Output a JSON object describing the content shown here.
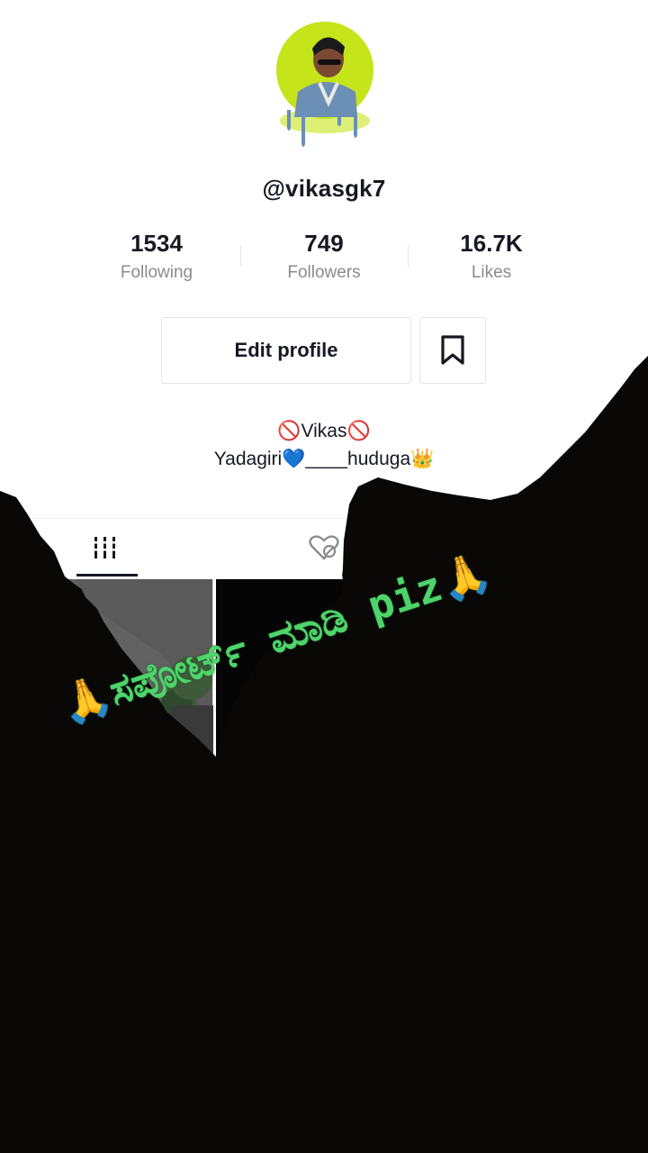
{
  "profile": {
    "username": "@vikasgk7",
    "stats": [
      {
        "value": "1534",
        "label": "Following"
      },
      {
        "value": "749",
        "label": "Followers"
      },
      {
        "value": "16.7K",
        "label": "Likes"
      }
    ],
    "edit_label": "Edit profile",
    "bio_line1": "🚫Vikas🚫",
    "bio_line2": "Yadagiri💙____huduga👑"
  },
  "tabs": [
    {
      "icon": "grid-icon",
      "active": true
    },
    {
      "icon": "liked-hidden-icon",
      "active": false
    }
  ],
  "overlay": {
    "caption": "🙏ಸಪೋರ್ಟ್ ಮಾಡಿ piz🙏",
    "caption_color": "#4ed46b"
  },
  "colors": {
    "avatar_ring": "#c6e41a",
    "text_primary": "#161823",
    "text_secondary": "#8a8b91"
  }
}
